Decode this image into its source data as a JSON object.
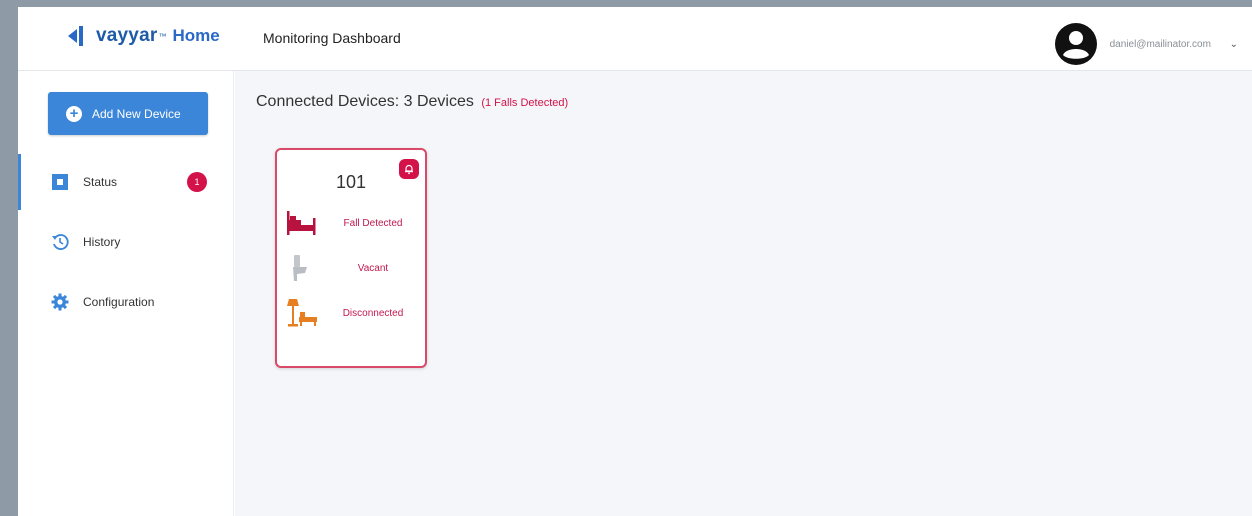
{
  "header": {
    "logo_word": "vayyar",
    "logo_tm": "™",
    "logo_home": "Home",
    "page_title": "Monitoring Dashboard",
    "user_email": "daniel@mailinator.com"
  },
  "sidebar": {
    "add_button": "Add New Device",
    "items": [
      {
        "label": "Status",
        "icon": "status-square-icon",
        "badge": "1",
        "active": true
      },
      {
        "label": "History",
        "icon": "history-icon"
      },
      {
        "label": "Configuration",
        "icon": "gear-icon"
      }
    ]
  },
  "main": {
    "heading": "Connected Devices: 3 Devices",
    "falls": "(1 Falls Detected)",
    "devices": [
      {
        "room": "101",
        "alert_icon": "alarm-bell-icon",
        "statuses": [
          {
            "label": "Fall Detected",
            "icon": "bed-fall-icon"
          },
          {
            "label": "Vacant",
            "icon": "toilet-icon"
          },
          {
            "label": "Disconnected",
            "icon": "lamp-armchair-icon"
          }
        ]
      }
    ]
  },
  "colors": {
    "brand": "#1d5aa8",
    "accent": "#3b86d8",
    "alert": "#d3124a",
    "fall_icon": "#b8123f",
    "vacant_icon": "#b9bec4",
    "disconnected_icon": "#e67e22"
  }
}
